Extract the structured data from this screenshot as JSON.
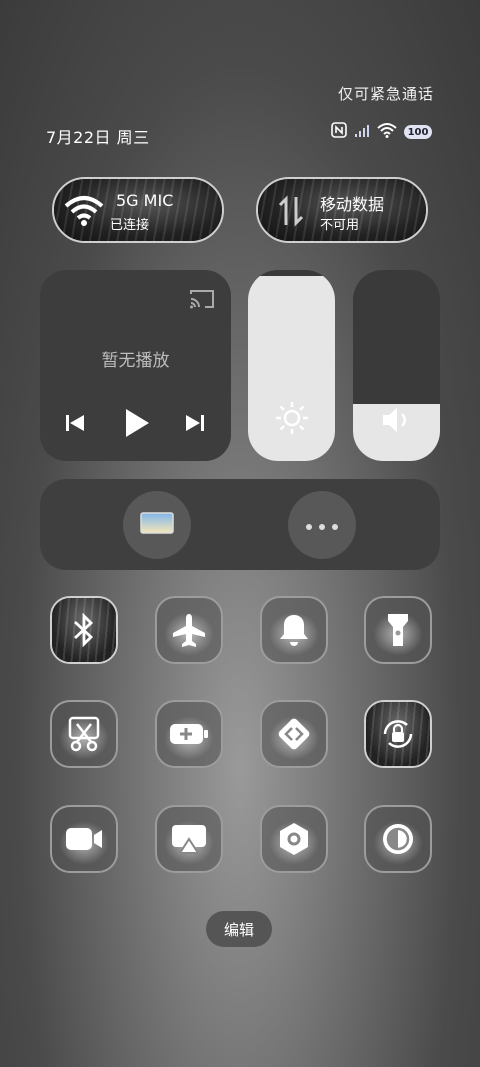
{
  "status": {
    "emergency_text": "仅可紧急通话",
    "date": "7月22日 周三",
    "battery": "100"
  },
  "wifi_pill": {
    "title": "5G    MIC",
    "subtitle": "已连接"
  },
  "data_pill": {
    "title": "移动数据",
    "subtitle": "不可用"
  },
  "media": {
    "label": "暂无播放"
  },
  "brightness": {
    "level": 0.97
  },
  "volume": {
    "level": 0.3
  },
  "footer": {
    "edit_label": "编辑"
  },
  "tiles": [
    "bluetooth",
    "airplane",
    "bell",
    "flashlight",
    "screenshot",
    "battery-saver",
    "nearby-share",
    "lock-rotation",
    "video-record",
    "screen-cast",
    "settings",
    "dark-mode"
  ]
}
